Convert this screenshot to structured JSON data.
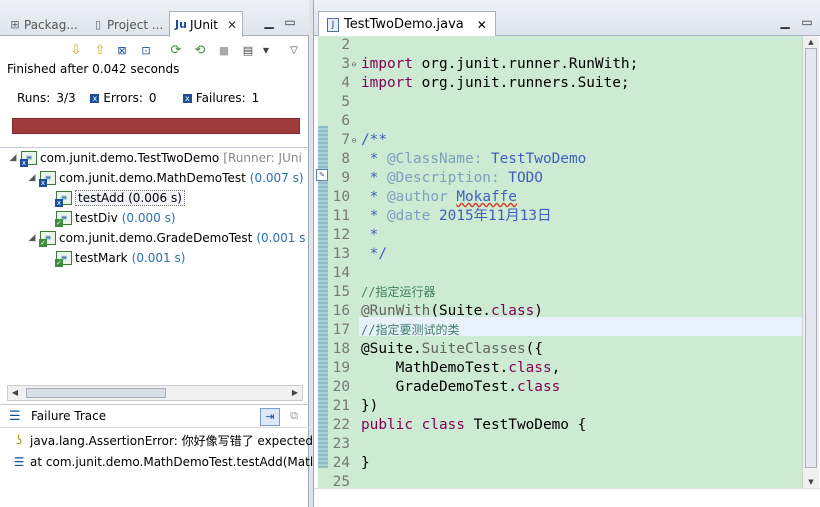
{
  "left_tabs": [
    {
      "label": "Packag...",
      "icon": "package-icon"
    },
    {
      "label": "Project ...",
      "icon": "project-icon"
    },
    {
      "label": "JUnit",
      "icon": "junit-icon",
      "active": true,
      "close": "✕"
    }
  ],
  "junit": {
    "finished": "Finished after 0.042 seconds",
    "runs_label": "Runs:",
    "runs_value": "3/3",
    "errors_label": "Errors:",
    "errors_value": "0",
    "failures_label": "Failures:",
    "failures_value": "1",
    "progress_color": "#9e3b3b",
    "tree": [
      {
        "label": "com.junit.demo.TestTwoDemo",
        "runner": "[Runner: JUni",
        "icon": "failed-suite-icon"
      },
      {
        "label": "com.junit.demo.MathDemoTest",
        "time": "(0.007 s)",
        "icon": "failed-suite-icon"
      },
      {
        "label": "testAdd",
        "time": "(0.006 s)",
        "icon": "failed-test-icon",
        "selected": true
      },
      {
        "label": "testDiv",
        "time": "(0.000 s)",
        "icon": "passed-test-icon"
      },
      {
        "label": "com.junit.demo.GradeDemoTest",
        "time": "(0.001 s",
        "icon": "passed-suite-icon"
      },
      {
        "label": "testMark",
        "time": "(0.001 s)",
        "icon": "passed-test-icon"
      }
    ],
    "failure_trace_title": "Failure Trace",
    "trace": [
      "java.lang.AssertionError: 你好像写错了 expected:",
      "at com.junit.demo.MathDemoTest.testAdd(Matl"
    ]
  },
  "editor": {
    "tab_label": "TestTwoDemo.java",
    "close": "✕",
    "lines": [
      {
        "n": "2",
        "html": ""
      },
      {
        "n": "3",
        "html": "<span class=\"k\">import</span> org.junit.runner.RunWith;"
      },
      {
        "n": "4",
        "html": "<span class=\"k\">import</span> org.junit.runners.Suite;"
      },
      {
        "n": "5",
        "html": ""
      },
      {
        "n": "6",
        "html": ""
      },
      {
        "n": "7",
        "html": "<span class=\"jd\">/**</span>"
      },
      {
        "n": "8",
        "html": "<span class=\"jd\"> * <span class=\"tag\">@ClassName:</span> TestTwoDemo</span>"
      },
      {
        "n": "9",
        "html": "<span class=\"jd\"> * <span class=\"tag\">@Description:</span> TODO</span>"
      },
      {
        "n": "10",
        "html": "<span class=\"jd\"> * <span class=\"tag\">@author</span> <span class=\"squig\">Mokaffe</span></span>"
      },
      {
        "n": "11",
        "html": "<span class=\"jd\"> * <span class=\"tag\">@date</span> 2015年11月13日</span>"
      },
      {
        "n": "12",
        "html": "<span class=\"jd\"> *</span>"
      },
      {
        "n": "13",
        "html": "<span class=\"jd\"> */</span>"
      },
      {
        "n": "14",
        "html": ""
      },
      {
        "n": "15",
        "html": "<span class=\"c\">//指定运行器</span>"
      },
      {
        "n": "16",
        "html": "<span class=\"an\">@RunWith</span>(Suite.<span class=\"k\">class</span>)"
      },
      {
        "n": "17",
        "html": "<span class=\"c\">//指定要测试的类</span>"
      },
      {
        "n": "18",
        "html": "@Suite.<span class=\"an\">SuiteClasses</span>({"
      },
      {
        "n": "19",
        "html": "    MathDemoTest.<span class=\"k\">class</span>,"
      },
      {
        "n": "20",
        "html": "    GradeDemoTest.<span class=\"k\">class</span>"
      },
      {
        "n": "21",
        "html": "})"
      },
      {
        "n": "22",
        "html": "<span class=\"k\">public</span> <span class=\"k\">class</span> TestTwoDemo {"
      },
      {
        "n": "23",
        "html": ""
      },
      {
        "n": "24",
        "html": "}"
      },
      {
        "n": "25",
        "html": ""
      }
    ]
  }
}
